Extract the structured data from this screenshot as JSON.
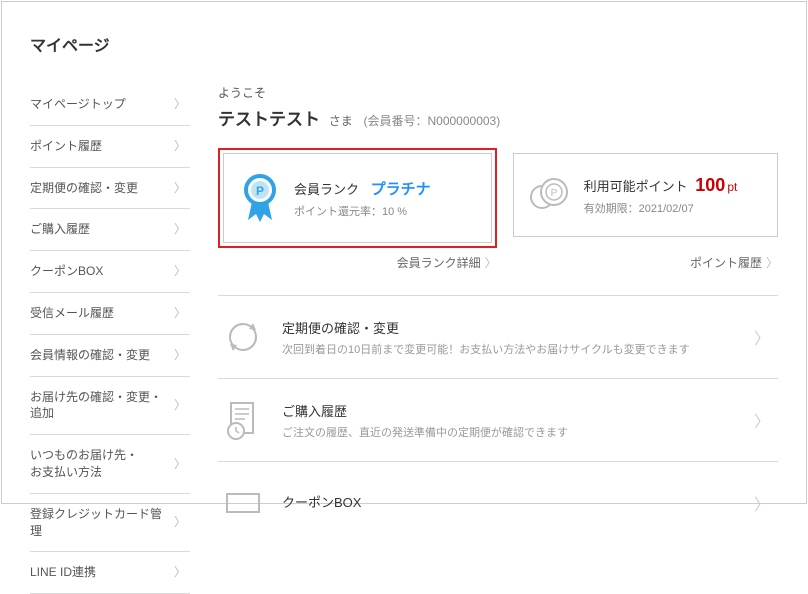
{
  "page_title": "マイページ",
  "sidebar": {
    "items": [
      "マイページトップ",
      "ポイント履歴",
      "定期便の確認・変更",
      "ご購入履歴",
      "クーポンBOX",
      "受信メール履歴",
      "会員情報の確認・変更",
      "お届け先の確認・変更・追加",
      "いつものお届け先・\nお支払い方法",
      "登録クレジットカード管理",
      "LINE ID連携"
    ]
  },
  "welcome": "ようこそ",
  "user": {
    "name": "テストテスト",
    "suffix": "さま",
    "member_no_label": "(会員番号：N000000003)"
  },
  "rank_card": {
    "title": "会員ランク",
    "value": "プラチナ",
    "sub_label": "ポイント還元率：",
    "sub_value": "10 %",
    "link": "会員ランク詳細"
  },
  "points_card": {
    "title": "利用可能ポイント",
    "value": "100",
    "unit": "pt",
    "sub_label": "有効期限：",
    "sub_value": "2021/02/07",
    "link": "ポイント履歴"
  },
  "quick_links": [
    {
      "title": "定期便の確認・変更",
      "sub": "次回到着日の10日前まで変更可能！お支払い方法やお届けサイクルも変更できます"
    },
    {
      "title": "ご購入履歴",
      "sub": "ご注文の履歴、直近の発送準備中の定期便が確認できます"
    },
    {
      "title": "クーポンBOX",
      "sub": ""
    }
  ]
}
